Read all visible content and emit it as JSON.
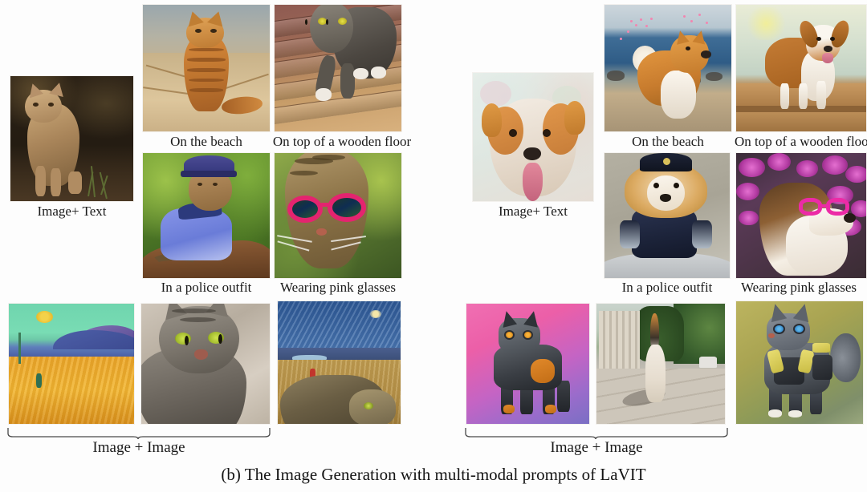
{
  "figure": {
    "caption": "(b) The Image Generation with multi-modal prompts of LaVIT",
    "background_color": "#fdfdfd",
    "text_color": "#141414"
  },
  "panels": [
    {
      "id": "left-cat-panel",
      "subject": "cat",
      "source": {
        "label": "Image+ Text",
        "alt": "Ginger tabby cat sitting on dark forest ground"
      },
      "grid": [
        {
          "label": "On the beach",
          "alt": "Orange striped cat sitting on sandy beach"
        },
        {
          "label": "On top of a wooden floor",
          "alt": "Grey tabby cat with yellow eyes on wooden deck planks"
        },
        {
          "label": "In a police outfit",
          "alt": "Cat wearing blue police shirt and cap on a log with green foliage"
        },
        {
          "label": "Wearing pink glasses",
          "alt": "Tabby cat wearing bright pink round sunglasses"
        }
      ],
      "composition": {
        "label": "Image + Image",
        "inputs": [
          {
            "alt": "Van Gogh Wheatfield with Reaper painting, green sky and golden wheat"
          },
          {
            "alt": "Photograph of a grey striped tabby cat with green eyes"
          }
        ],
        "output": {
          "alt": "Van Gogh style painting of a tabby cat in a wheatfield under a starry blue sky"
        }
      }
    },
    {
      "id": "right-dog-panel",
      "subject": "dog",
      "source": {
        "label": "Image+ Text",
        "alt": "Corgi dog close-up with tongue out against soft blossom background"
      },
      "grid": [
        {
          "label": "On the beach",
          "alt": "Fluffy orange and white dog standing on a beach by the sea with pink petals"
        },
        {
          "label": "On top of a wooden floor",
          "alt": "Papillon dog standing on a wooden table against pale green background"
        },
        {
          "label": "In a police outfit",
          "alt": "Pomeranian puppy dressed in a navy police uniform"
        },
        {
          "label": "Wearing pink glasses",
          "alt": "Papillon dog wearing pink glasses in front of purple flowers"
        }
      ],
      "composition": {
        "label": "Image + Image",
        "inputs": [
          {
            "alt": "Stylized armored dog with orange goggles on pink purple gradient background"
          },
          {
            "alt": "Photograph of a calico cat walking on a pavement street with tail raised"
          }
        ],
        "output": {
          "alt": "Stylized armored cat with blue goggles and yellow black armor on olive background"
        }
      }
    }
  ]
}
